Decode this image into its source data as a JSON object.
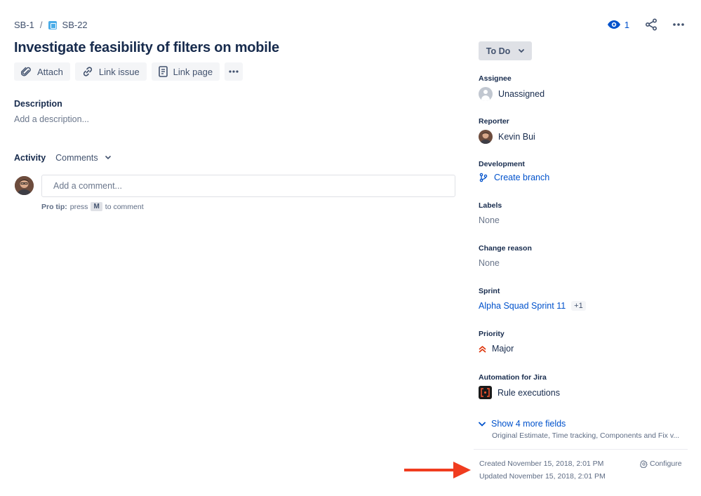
{
  "breadcrumb": {
    "parent": "SB-1",
    "separator": "/",
    "current": "SB-22"
  },
  "header": {
    "watch_count": "1"
  },
  "issue": {
    "title": "Investigate feasibility of filters on mobile"
  },
  "toolbar": {
    "attach": "Attach",
    "link_issue": "Link issue",
    "link_page": "Link page"
  },
  "description": {
    "label": "Description",
    "placeholder": "Add a description..."
  },
  "activity": {
    "label": "Activity",
    "filter": "Comments"
  },
  "comment": {
    "placeholder": "Add a comment...",
    "protip_label": "Pro tip:",
    "protip_press": "press",
    "protip_key": "M",
    "protip_suffix": "to comment"
  },
  "status": {
    "label": "To Do"
  },
  "fields": {
    "assignee": {
      "label": "Assignee",
      "value": "Unassigned"
    },
    "reporter": {
      "label": "Reporter",
      "value": "Kevin Bui"
    },
    "development": {
      "label": "Development",
      "value": "Create branch"
    },
    "labels": {
      "label": "Labels",
      "value": "None"
    },
    "change_reason": {
      "label": "Change reason",
      "value": "None"
    },
    "sprint": {
      "label": "Sprint",
      "value": "Alpha Squad Sprint 11",
      "extra": "+1"
    },
    "priority": {
      "label": "Priority",
      "value": "Major"
    },
    "automation": {
      "label": "Automation for Jira",
      "value": "Rule executions"
    }
  },
  "more_fields": {
    "label": "Show 4 more fields",
    "sub": "Original Estimate, Time tracking, Components and Fix v..."
  },
  "footer": {
    "created": "Created November 15, 2018, 2:01 PM",
    "updated": "Updated November 15, 2018, 2:01 PM",
    "configure": "Configure"
  },
  "colors": {
    "accent": "#0052cc",
    "priority": "#de350b",
    "annotation_arrow": "#f03c1f"
  },
  "icons": [
    "story-icon",
    "eye-icon",
    "share-icon",
    "more-icon",
    "paperclip-icon",
    "link-icon",
    "page-icon",
    "chevron-down-icon",
    "branch-icon",
    "priority-major-icon",
    "gear-icon",
    "rule-icon"
  ]
}
